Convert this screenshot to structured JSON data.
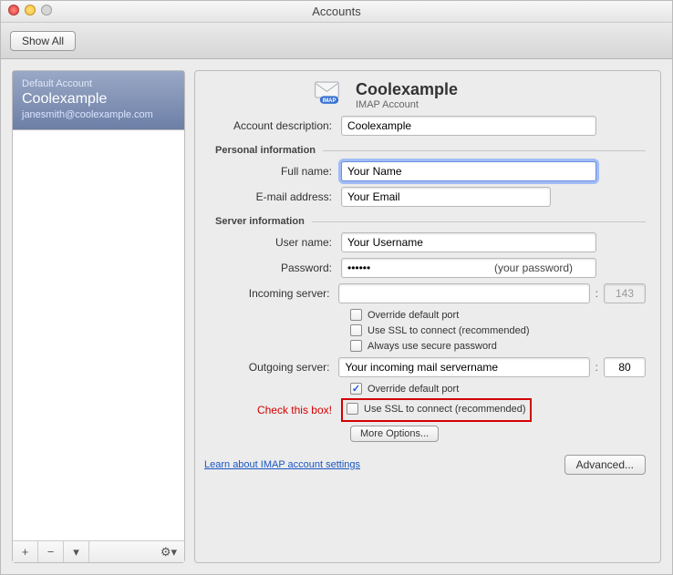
{
  "window": {
    "title": "Accounts"
  },
  "toolbar": {
    "show_all": "Show All"
  },
  "sidebar": {
    "default_label": "Default Account",
    "account_name": "Coolexample",
    "account_email": "janesmith@coolexample.com",
    "buttons": {
      "add": "+",
      "remove": "−",
      "dropdown": "▾",
      "gear": "⚙▾"
    }
  },
  "header": {
    "title": "Coolexample",
    "subtitle": "IMAP Account"
  },
  "sections": {
    "personal": "Personal information",
    "server": "Server information"
  },
  "labels": {
    "description": "Account description:",
    "full_name": "Full name:",
    "email": "E-mail address:",
    "user": "User name:",
    "password": "Password:",
    "incoming": "Incoming server:",
    "outgoing": "Outgoing server:",
    "check_box": "Check this box!"
  },
  "values": {
    "description": "Coolexample",
    "full_name": "Your Name",
    "email": "Your Email",
    "user": "Your Username",
    "password": "••••••",
    "password_hint": "(your password)",
    "incoming": "",
    "incoming_port": "143",
    "outgoing": "Your incoming mail servername",
    "outgoing_port": "80"
  },
  "checks": {
    "override_in": "Override default port",
    "ssl_in": "Use SSL to connect (recommended)",
    "secure_pw": "Always use secure password",
    "override_out": "Override default port",
    "ssl_out": "Use SSL to connect (recommended)"
  },
  "buttons": {
    "more_options": "More Options...",
    "advanced": "Advanced..."
  },
  "link": {
    "learn": "Learn about IMAP account settings"
  }
}
